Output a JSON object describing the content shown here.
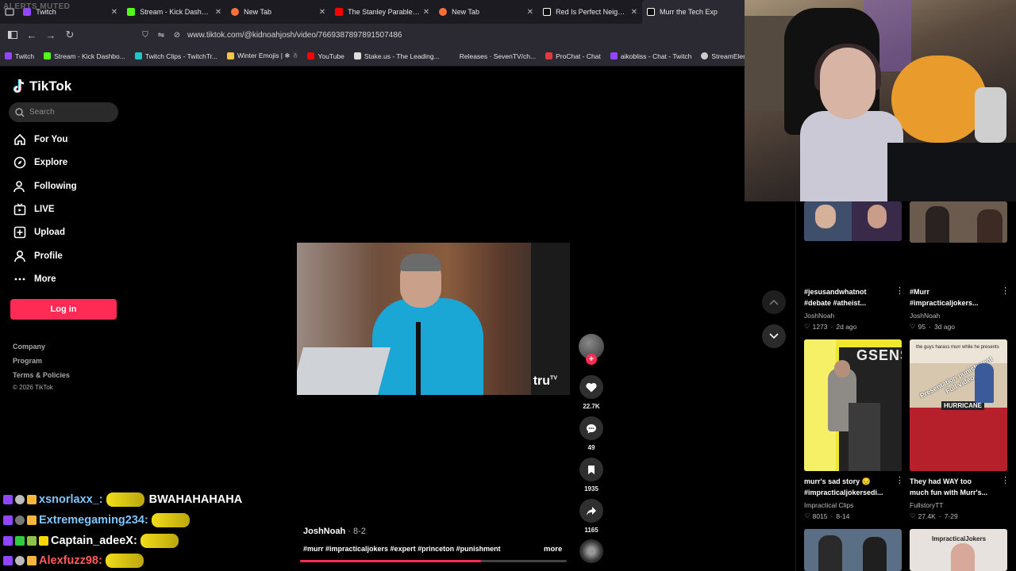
{
  "browser": {
    "alerts_muted": "ALERTS MUTED",
    "tabs": [
      {
        "label": "Twitch",
        "color": "#9146ff"
      },
      {
        "label": "Stream - Kick Dashboard",
        "color": "#53fc18"
      },
      {
        "label": "New Tab",
        "color": "#ff7139"
      },
      {
        "label": "The Stanley Parable Ultra D",
        "color": "#ff0000"
      },
      {
        "label": "New Tab",
        "color": "#ff7139"
      },
      {
        "label": "Red Is Perfect Neighborhoo",
        "color": "#ffffff"
      },
      {
        "label": "Murr the Tech Exp",
        "color": "#ffffff"
      }
    ],
    "url": "www.tiktok.com/@kidnoahjosh/video/7669387897891507486",
    "bookmarks": [
      {
        "label": "Twitch",
        "color": "#9146ff"
      },
      {
        "label": "Stream - Kick Dashbo...",
        "color": "#53fc18"
      },
      {
        "label": "Twitch Clips - TwitchTr...",
        "color": "#1ec8c8"
      },
      {
        "label": "Winter Emojis | ❄ ☃",
        "color": "#f2c744"
      },
      {
        "label": "YouTube",
        "color": "#ff0000"
      },
      {
        "label": "Stake.us - The Leading...",
        "color": "#dddddd"
      },
      {
        "label": "Releases · SevenTV/ch...",
        "color": "#2b2a33"
      },
      {
        "label": "ProChat - Chat",
        "color": "#e03a3a"
      },
      {
        "label": "aikobliss - Chat - Twitch",
        "color": "#9146ff"
      },
      {
        "label": "StreamElements - Das...",
        "color": "#cccccc"
      }
    ]
  },
  "tiktok": {
    "logo": "TikTok",
    "search_placeholder": "Search",
    "nav": [
      "For You",
      "Explore",
      "Following",
      "LIVE",
      "Upload",
      "Profile",
      "More"
    ],
    "login": "Log in",
    "footer": [
      "Company",
      "Program",
      "Terms & Policies"
    ],
    "copyright": "© 2026 TikTok",
    "video": {
      "watermark": "tru",
      "likes": "22.7K",
      "comments": "49",
      "saves": "1935",
      "shares": "1165",
      "author": "JoshNoah",
      "date": " · 8-2",
      "caption": "#murr #impracticaljokers #expert #princeton #punishment",
      "more": "more",
      "progress": 0.68
    },
    "related": [
      {
        "title1": "#jesusandwhatnot",
        "title2": "#debate #atheist...",
        "author": "JoshNoah",
        "likes": "1273",
        "age": "2d ago"
      },
      {
        "title1": "#Murr",
        "title2": "#impracticaljokers...",
        "author": "JoshNoah",
        "likes": "95",
        "age": "3d ago"
      },
      {
        "title1": "murr's sad story 😔",
        "title2": "#impracticaljokersedi...",
        "author": "Impractical Clips",
        "likes": "8015",
        "age": "8-14",
        "thumb_text": "GSENSE  UR"
      },
      {
        "title1": "They had WAY too",
        "title2": "much fun with Murr's...",
        "author": "FullstoryTT",
        "likes": "27.4K",
        "age": "7-29",
        "thumb_text": "Presentation punishment\nFull video",
        "thumb_top": "the guys harass murr while he presents",
        "thumb_sign": "HURRICANE"
      },
      {
        "title1": "",
        "title2": "",
        "author": "",
        "likes": "",
        "age": ""
      },
      {
        "title1": "",
        "title2": "",
        "author": "",
        "likes": "",
        "age": "",
        "thumb_text": "ImpracticalJokers"
      }
    ]
  },
  "chat": [
    {
      "user": "xsnorlaxx_:",
      "msg": "BWAHAHAHAHA",
      "color": "#7fc6ff"
    },
    {
      "user": "Extremegaming234:",
      "msg": "",
      "color": "#7fc6ff"
    },
    {
      "user": "Captain_adeeX:",
      "msg": "",
      "color": "#ffffff"
    },
    {
      "user": "Alexfuzz98:",
      "msg": "",
      "color": "#ff5a5a"
    }
  ]
}
